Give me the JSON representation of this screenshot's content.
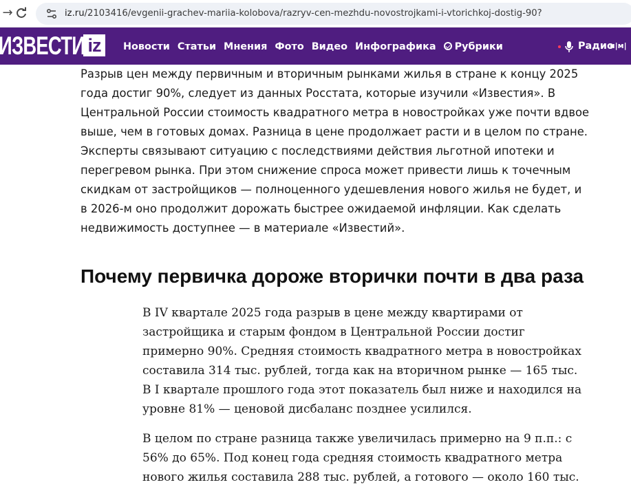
{
  "browser": {
    "url_host": "iz.ru",
    "url_path": "/2103416/evgenii-grachev-mariia-kolobova/razryv-cen-mezhdu-novostrojkami-i-vtorichkoj-dostig-90?"
  },
  "header": {
    "logo_text": "ИЗВЕСТИЯ",
    "logo_badge": "iz",
    "nav_items": [
      "Новости",
      "Статьи",
      "Мнения",
      "Фото",
      "Видео",
      "Инфографика"
    ],
    "rubrics_label": "Рубрики",
    "radio_label": "Радио",
    "partner_logos_text": "ʜ|ᴍ|",
    "background_color": "#4f1d80"
  },
  "article": {
    "lead_text": "Разрыв цен между первичным и вторичным рынками жилья в стране к концу 2025 года достиг 90%, следует из данных Росстата, которые изучили «Известия». В Центральной России стоимость квадратного метра в новостройках уже почти вдвое выше, чем в готовых домах. Разница в цене продолжает расти и в целом по стране. Эксперты связывают ситуацию с последствиями действия льготной ипотеки и перегревом рынка. При этом снижение спроса может привести лишь к точечным скидкам от застройщиков — полноценного удешевления нового жилья не будет, и в 2026-м оно продолжит дорожать быстрее ожидаемой инфляции. Как сделать недвижимость доступнее — в материале «Известий».",
    "section_heading": "Почему первичка дороже вторички почти в два раза",
    "paragraphs": [
      "В IV квартале 2025 года разрыв в цене между квартирами от застройщика и старым фондом в Центральной России достиг примерно 90%. Средняя стоимость квадратного метра в новостройках составила 314 тыс. рублей, тогда как на вторичном рынке — 165 тыс. В I квартале прошлого года этот показатель был ниже и находился на уровне 81% — ценовой дисбаланс позднее усилился.",
      "В целом по стране разница также увеличилась примерно на 9 п.п.: с 56% до 65%. Под конец года средняя стоимость квадратного метра нового жилья составила 288 тыс. рублей, а готового — около 160 тыс."
    ]
  }
}
